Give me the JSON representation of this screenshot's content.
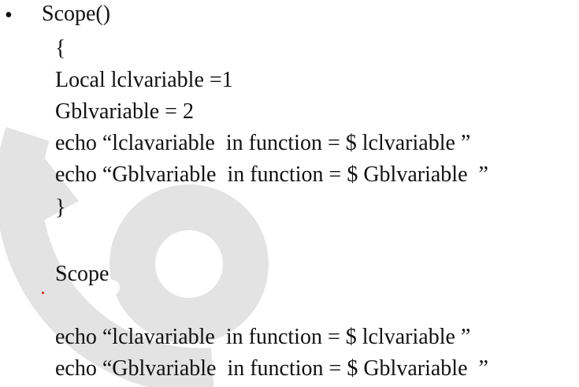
{
  "colors": {
    "text": "#111111",
    "watermark": "#e3e3e3",
    "dot": "#cc2222"
  },
  "bullet": "•",
  "code_lines": [
    "Scope()",
    "{",
    "Local lclvariable =1",
    "Gblvariable = 2",
    "echo “lclavariable  in function = $ lclvariable ”",
    "echo “Gblvariable  in function = $ Gblvariable  ”",
    "}",
    "Scope",
    "echo “lclavariable  in function = $ lclvariable ”",
    "echo “Gblvariable  in function = $ Gblvariable  ”"
  ]
}
